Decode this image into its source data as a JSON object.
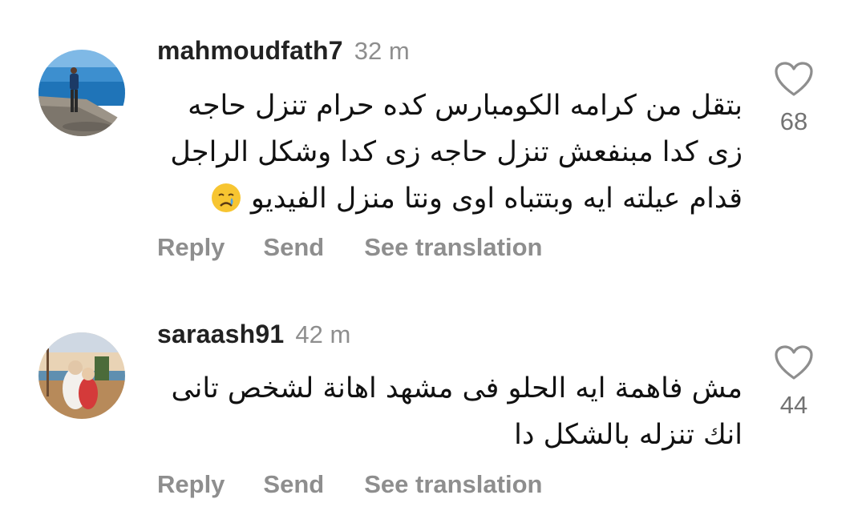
{
  "comments": [
    {
      "username": "mahmoudfath7",
      "time": "32 m",
      "text": "بتقل من كرامه الكومبارس كده حرام تنزل حاجه زى كدا مبنفعش تنزل حاجه زى كدا وشكل الراجل قدام عيلته ايه وبتتباه اوى ونتا منزل الفيديو",
      "emoji": "crying-face-emoji",
      "likes": "68",
      "actions": {
        "reply": "Reply",
        "send": "Send",
        "translate": "See translation"
      }
    },
    {
      "username": "saraash91",
      "time": "42 m",
      "text": "مش فاهمة ايه الحلو فى مشهد اهانة لشخص تانى انك تنزله بالشكل دا",
      "likes": "44",
      "actions": {
        "reply": "Reply",
        "send": "Send",
        "translate": "See translation"
      }
    }
  ],
  "colors": {
    "username": "#222222",
    "meta": "#8e8e8e",
    "text": "#111111",
    "heart_outline": "#8e8e8e"
  },
  "icons": {
    "like": "heart-outline-icon",
    "avatar_1": "beach-photo-avatar",
    "avatar_2": "family-photo-avatar"
  }
}
